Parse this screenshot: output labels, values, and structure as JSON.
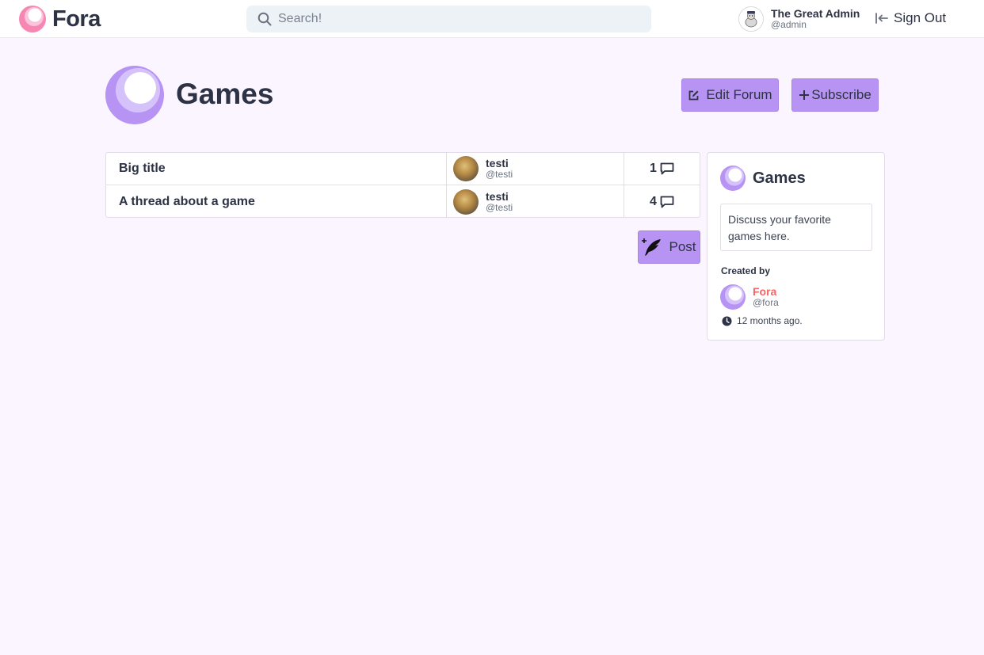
{
  "brand": {
    "name": "Fora"
  },
  "search": {
    "placeholder": "Search!"
  },
  "user": {
    "name": "The Great Admin",
    "handle": "@admin"
  },
  "signout": {
    "label": "Sign Out"
  },
  "forum": {
    "title": "Games",
    "edit_label": "Edit Forum",
    "subscribe_label": "Subscribe"
  },
  "threads": [
    {
      "title": "Big title",
      "author": "testi",
      "handle": "@testi",
      "count": "1"
    },
    {
      "title": "A thread about a game",
      "author": "testi",
      "handle": "@testi",
      "count": "4"
    }
  ],
  "post": {
    "label": "Post"
  },
  "sidebar": {
    "title": "Games",
    "description": "Discuss your favorite games here.",
    "created_label": "Created by",
    "creator_name": "Fora",
    "creator_handle": "@fora",
    "time": "12 months ago."
  },
  "colors": {
    "background": "#faf5ff",
    "accent": "#b794f4",
    "brand_pink": "#f687b3",
    "creator_red": "#f56565"
  },
  "icons": [
    "search-icon",
    "sign-out-icon",
    "edit-icon",
    "plus-icon",
    "comment-icon",
    "quill-icon",
    "clock-icon"
  ]
}
